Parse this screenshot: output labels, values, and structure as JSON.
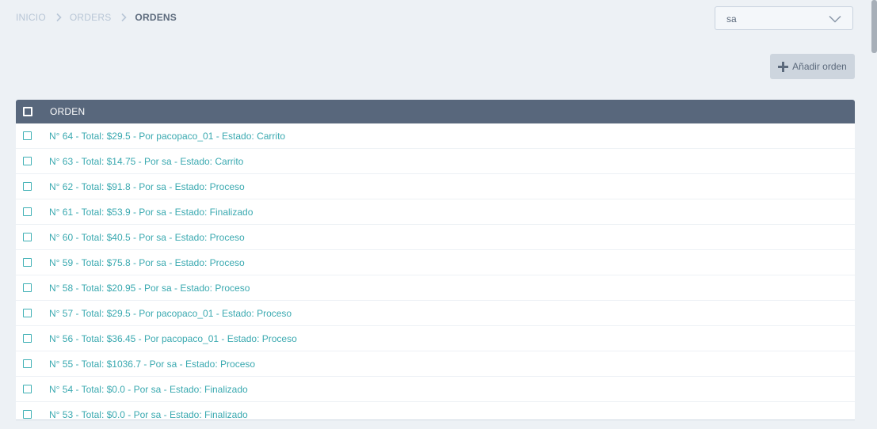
{
  "breadcrumb": {
    "items": [
      "INICIO",
      "ORDERS",
      "ORDENS"
    ]
  },
  "user_select": {
    "value": "sa"
  },
  "add_button": {
    "label": "Añadir orden"
  },
  "table": {
    "header": "ORDEN",
    "rows": [
      "N° 64 - Total: $29.5 - Por pacopaco_01 - Estado: Carrito",
      "N° 63 - Total: $14.75 - Por sa - Estado: Carrito",
      "N° 62 - Total: $91.8 - Por sa - Estado: Proceso",
      "N° 61 - Total: $53.9 - Por sa - Estado: Finalizado",
      "N° 60 - Total: $40.5 - Por sa - Estado: Proceso",
      "N° 59 - Total: $75.8 - Por sa - Estado: Proceso",
      "N° 58 - Total: $20.95 - Por sa - Estado: Proceso",
      "N° 57 - Total: $29.5 - Por pacopaco_01 - Estado: Proceso",
      "N° 56 - Total: $36.45 - Por pacopaco_01 - Estado: Proceso",
      "N° 55 - Total: $1036.7 - Por sa - Estado: Proceso",
      "N° 54 - Total: $0.0 - Por sa - Estado: Finalizado",
      "N° 53 - Total: $0.0 - Por sa - Estado: Finalizado"
    ]
  },
  "icons": {
    "breadcrumb_separator": "chevron-right-icon",
    "select_arrow": "chevron-down-icon",
    "add": "plus-icon",
    "checkbox": "checkbox-icon"
  },
  "colors": {
    "background": "#edf1f5",
    "table_header": "#58677c",
    "link": "#3aa9b0",
    "checkbox": "#3fb0b5",
    "button_bg": "#cdd5de",
    "text_muted": "#b8c6d6",
    "text_dark": "#5c6a7c"
  }
}
